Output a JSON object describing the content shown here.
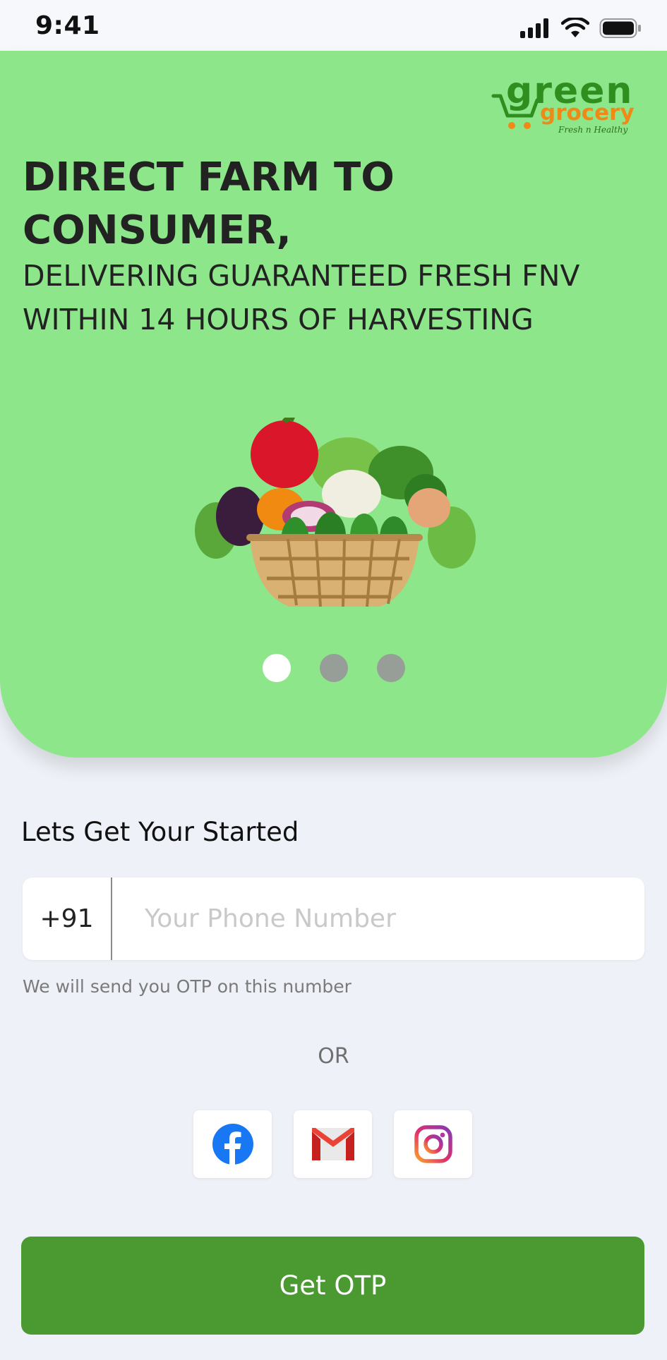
{
  "status_bar": {
    "time": "9:41",
    "icons": [
      "cellular-signal-icon",
      "wifi-icon",
      "battery-icon"
    ]
  },
  "hero": {
    "logo_text": {
      "line1": "green",
      "line2": "grocery",
      "tagline": "Fresh n Healthy"
    },
    "headline": "DIRECT FARM TO CONSUMER,",
    "subline": "DELIVERING GUARANTEED FRESH FNV WITHIN 14 HOURS OF HARVESTING",
    "image_icon": "vegetable-basket-icon",
    "carousel": {
      "total": 3,
      "active_index": 0
    }
  },
  "login": {
    "title": "Lets Get Your Started",
    "country_code": "+91",
    "phone_placeholder": "Your Phone Number",
    "phone_value": "",
    "hint": "We will send you OTP on this number",
    "or_text": "OR",
    "social_icons": [
      "facebook-icon",
      "gmail-icon",
      "instagram-icon"
    ],
    "submit_label": "Get OTP"
  },
  "colors": {
    "hero_bg": "#8de68a",
    "primary_button": "#4a9a31",
    "page_bg": "#eef1f7",
    "logo_green": "#2f8f1e",
    "logo_orange": "#f08a17"
  }
}
